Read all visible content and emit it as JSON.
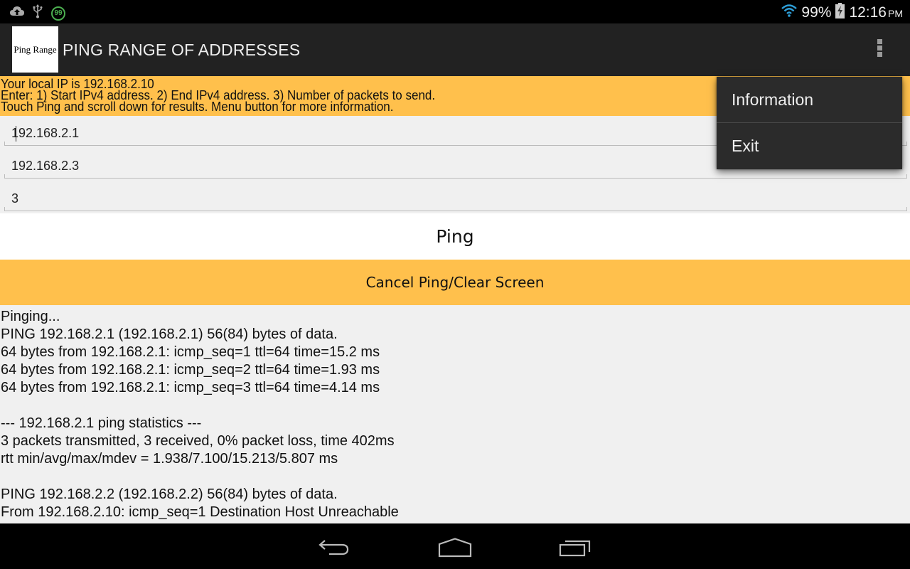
{
  "status_bar": {
    "left_icons": [
      "cloud-upload-icon",
      "usb-icon",
      "notification-count-icon"
    ],
    "notification_count": "99",
    "battery_percent": "99%",
    "time": "12:16",
    "ampm": "PM",
    "right_icons": [
      "wifi-icon",
      "battery-charging-icon"
    ]
  },
  "action_bar": {
    "logo_text": "Ping Range",
    "title": "PING RANGE OF ADDRESSES",
    "overflow_icon": "more-vert-icon"
  },
  "info_banner": {
    "lines": [
      "Your local IP is 192.168.2.10",
      "Enter: 1) Start IPv4 address. 2) End IPv4 address. 3) Number of packets to send.",
      "Touch Ping and scroll down for results. Menu button for more information."
    ]
  },
  "form": {
    "start_ip": "192.168.2.1",
    "end_ip": "192.168.2.3",
    "packet_count": "3"
  },
  "buttons": {
    "ping": "Ping",
    "cancel": "Cancel Ping/Clear Screen"
  },
  "output": {
    "lines": [
      "Pinging...",
      "PING 192.168.2.1 (192.168.2.1) 56(84) bytes of data.",
      "64 bytes from 192.168.2.1: icmp_seq=1 ttl=64 time=15.2 ms",
      "64 bytes from 192.168.2.1: icmp_seq=2 ttl=64 time=1.93 ms",
      "64 bytes from 192.168.2.1: icmp_seq=3 ttl=64 time=4.14 ms",
      "",
      "--- 192.168.2.1 ping statistics ---",
      "3 packets transmitted, 3 received, 0% packet loss, time 402ms",
      "rtt min/avg/max/mdev = 1.938/7.100/15.213/5.807 ms",
      "",
      "PING 192.168.2.2 (192.168.2.2) 56(84) bytes of data.",
      "From 192.168.2.10: icmp_seq=1 Destination Host Unreachable"
    ]
  },
  "popup_menu": {
    "items": [
      {
        "label": "Information"
      },
      {
        "label": "Exit"
      }
    ]
  },
  "nav_bar": {
    "buttons": [
      "back-icon",
      "home-icon",
      "recent-apps-icon"
    ]
  },
  "colors": {
    "accent": "#ffc04c",
    "action_bar": "#222222",
    "menu_bg": "#2b2b2b",
    "content_bg": "#f0f0f0"
  }
}
